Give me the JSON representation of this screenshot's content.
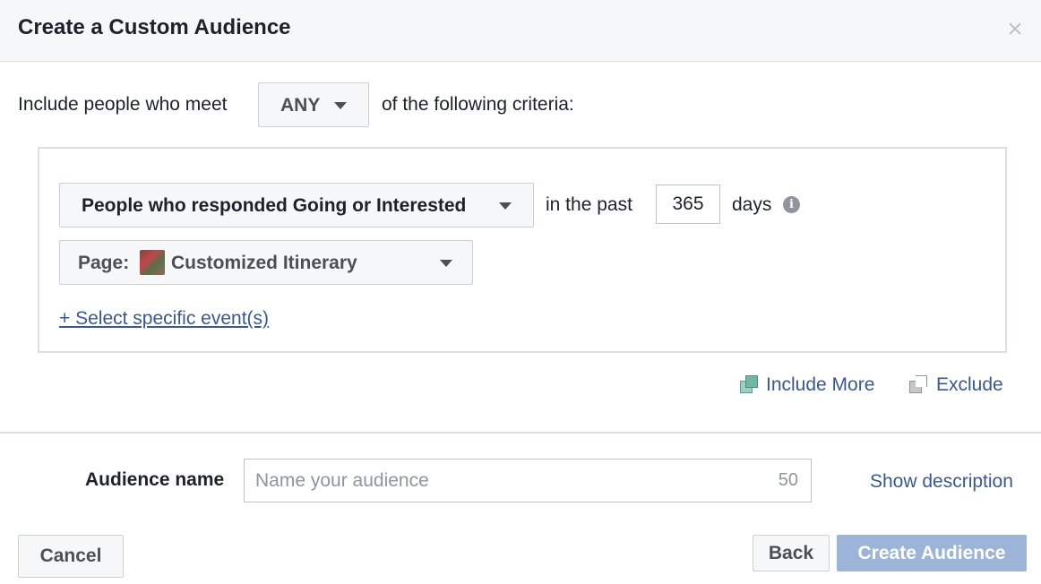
{
  "dialog": {
    "title": "Create a Custom Audience",
    "close_glyph": "×"
  },
  "criteria": {
    "prefix": "Include people who meet",
    "match_value": "ANY",
    "suffix": "of the following criteria:"
  },
  "rule": {
    "event_type": "People who responded Going or Interested",
    "in_the_past": "in the past",
    "days_value": "365",
    "days_label": "days",
    "info_glyph": "i",
    "page_prefix": "Page:",
    "page_name": "Customized Itinerary",
    "select_events": "+ Select specific event(s)"
  },
  "actions": {
    "include_more": "Include More",
    "exclude": "Exclude"
  },
  "audience_name": {
    "label": "Audience name",
    "placeholder": "Name your audience",
    "char_limit": "50",
    "show_description": "Show description"
  },
  "footer": {
    "cancel": "Cancel",
    "back": "Back",
    "create": "Create Audience"
  },
  "colors": {
    "link": "#365899",
    "create_disabled": "#9cb4d8",
    "header_bg": "#f6f7f9"
  }
}
